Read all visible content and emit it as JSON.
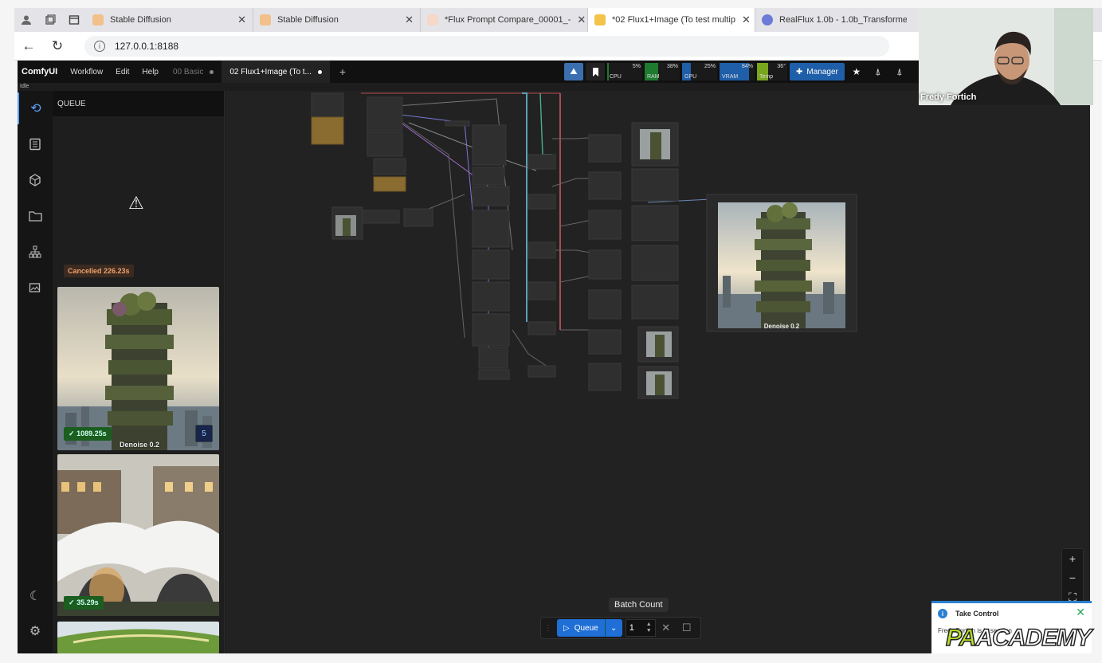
{
  "browser": {
    "tabs": [
      {
        "label": "Stable Diffusion",
        "active": false
      },
      {
        "label": "Stable Diffusion",
        "active": false
      },
      {
        "label": "*Flux Prompt Compare_00001_-",
        "active": false
      },
      {
        "label": "*02 Flux1+Image (To test multip",
        "active": true
      },
      {
        "label": "RealFlux 1.0b - 1.0b_Transformer",
        "active": false
      }
    ],
    "url": "127.0.0.1:8188"
  },
  "comfy": {
    "logo": "ComfyUI",
    "menu": [
      "Workflow",
      "Edit",
      "Help"
    ],
    "workflow_tabs": [
      {
        "label": "00 Basic",
        "active": false
      },
      {
        "label": "02 Flux1+Image (To t...",
        "active": true
      }
    ],
    "status": "Idle",
    "monitors": [
      {
        "label": "CPU",
        "pct": "5%",
        "color": "#1e7a2e",
        "value": 5
      },
      {
        "label": "RAM",
        "pct": "38%",
        "color": "#1e7a2e",
        "value": 38
      },
      {
        "label": "GPU",
        "pct": "25%",
        "color": "#1f5ea8",
        "value": 25
      },
      {
        "label": "VRAM",
        "pct": "84%",
        "color": "#1f5ea8",
        "value": 84
      },
      {
        "label": "Temp",
        "pct": "36°",
        "color": "#7aa61e",
        "value": 36
      }
    ],
    "manager_label": "Manager"
  },
  "queue": {
    "title": "QUEUE",
    "cancelled": "Cancelled 226.23s",
    "items": [
      {
        "time": "1089.25s",
        "count": "5",
        "caption": "Denoise 0.2"
      },
      {
        "time": "35.29s"
      }
    ]
  },
  "canvas": {
    "preview_caption": "Denoise 0.2"
  },
  "queue_bar": {
    "queue_label": "Queue",
    "batch_tooltip": "Batch Count",
    "batch_value": "1"
  },
  "webcam": {
    "name": "Fredy Fortich"
  },
  "notification": {
    "title": "Take Control",
    "body": "Fredy Fortich is in session"
  },
  "brand": {
    "pa": "PA",
    "rest": "ACADEMY"
  }
}
